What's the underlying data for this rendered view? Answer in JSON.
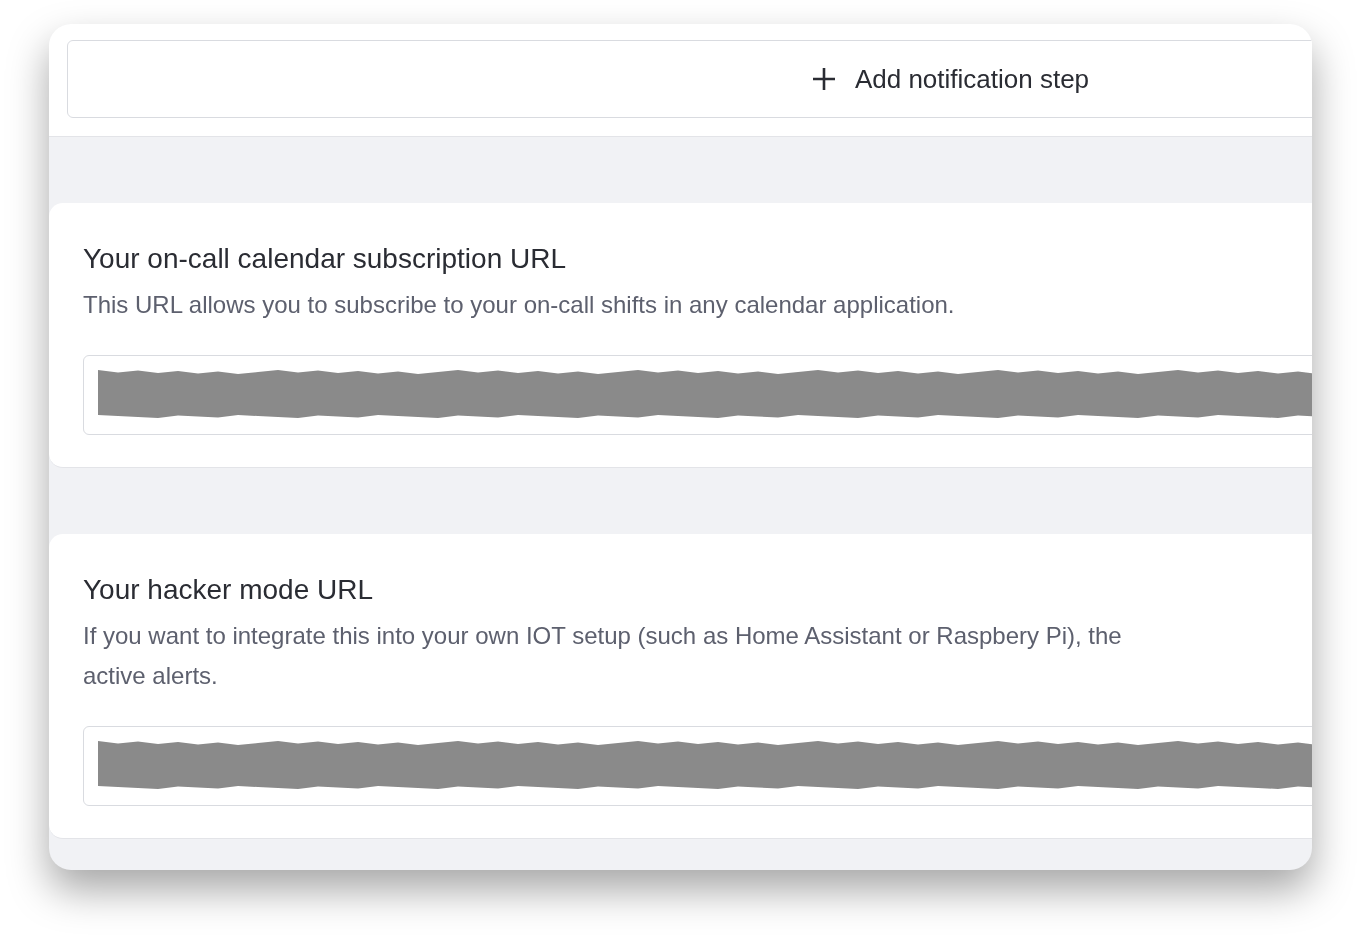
{
  "add_step_button": {
    "label": "Add notification step"
  },
  "sections": [
    {
      "title": "Your on-call calendar subscription URL",
      "description_lines": [
        "This URL allows you to subscribe to your on-call shifts in any calendar application."
      ],
      "field": {
        "redacted": true
      }
    },
    {
      "title": "Your hacker mode URL",
      "description_lines": [
        "If you want to integrate this into your own IOT setup (such as Home Assistant or Raspbery Pi), the",
        "active alerts."
      ],
      "field": {
        "redacted": true
      }
    }
  ]
}
